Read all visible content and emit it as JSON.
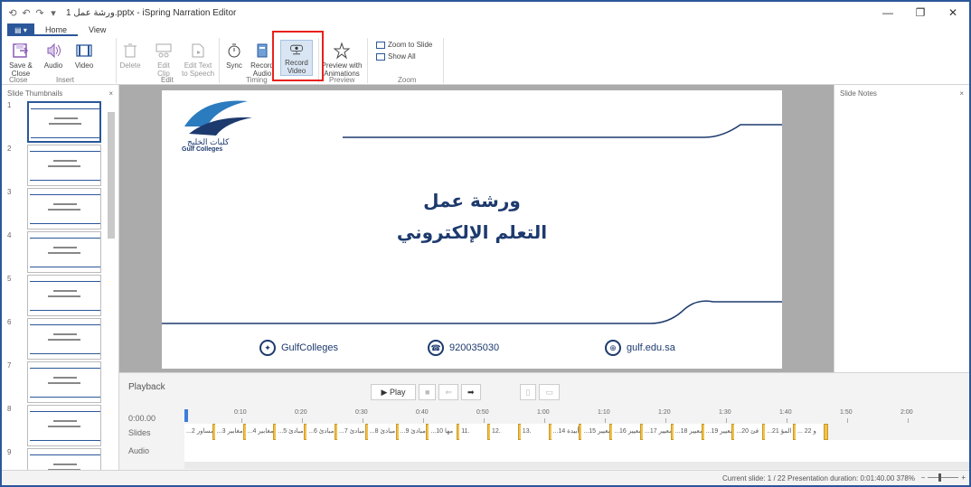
{
  "window": {
    "title": "ورشة عمل 1.pptx - iSpring Narration Editor",
    "controls": [
      "—",
      "❐",
      "✕"
    ]
  },
  "quick_access": [
    "⟲",
    "↶",
    "↷",
    "▾"
  ],
  "ribbon": {
    "file_tab": "▤ ▾",
    "tabs": [
      {
        "label": "Home",
        "active": true
      },
      {
        "label": "View",
        "active": false
      }
    ],
    "buttons": {
      "save_close": "Save &\nClose",
      "audio": "Audio",
      "video": "Video",
      "delete": "Delete",
      "edit_clip": "Edit\nClip",
      "edit_text_to_speech": "Edit Text\nto Speech",
      "sync": "Sync",
      "record_audio": "Record\nAudio",
      "record_video": "Record\nVideo",
      "preview_with_animations": "Preview with\nAnimations",
      "zoom_to_slide": "Zoom to Slide",
      "show_all": "Show All"
    },
    "groups": {
      "close": "Close",
      "insert": "Insert",
      "edit": "Edit",
      "timing": "Timing",
      "preview": "Preview",
      "zoom": "Zoom"
    },
    "accent_color": "#2b579a",
    "highlight_color": "#e8211c"
  },
  "thumbnails": {
    "title": "Slide Thumbnails",
    "close": "×",
    "items": [
      "1",
      "2",
      "3",
      "4",
      "5",
      "6",
      "7",
      "8",
      "9"
    ],
    "selected": "1"
  },
  "slide": {
    "logo_arabic": "كليات الخليج",
    "logo_english": "Gulf Colleges",
    "title_line1": "ورشة عمل",
    "title_line2": "التعلم الإلكتروني",
    "twitter": "GulfColleges",
    "phone": "920035030",
    "website": "gulf.edu.sa",
    "brand_color": "#1d3a6e"
  },
  "notes": {
    "title": "Slide Notes",
    "close": "×"
  },
  "playback": {
    "title": "Playback",
    "play_label": "▶ Play",
    "time": "0:00.00",
    "row_slides": "Slides",
    "row_audio": "Audio",
    "ruler_ticks": [
      "0:10",
      "0:20",
      "0:30",
      "0:40",
      "0:50",
      "1:00",
      "1:10",
      "1:20",
      "1:30",
      "1:40",
      "1:50",
      "2:00"
    ],
    "slide_segments": [
      "...مساور 2",
      "...مغابير 3",
      "...مغابير 4",
      "...مبادئ 5",
      "...مبادئ 6",
      "...مبادئ 7",
      "...مبادئ 8",
      "...مبادئ 9",
      "...مها 10",
      "11.",
      "12.",
      "13.",
      "...أبيدة 14",
      "...معيير 15",
      "...معيير 16",
      "...معيير 17",
      "...معيير 18",
      "...معيير 19",
      "...فئ 20",
      "...المؤ 21",
      "... و 22"
    ]
  },
  "status": {
    "text": "Current slide: 1 / 22   Presentation duration: 0:01:40.00   378%",
    "zoom_minus": "−",
    "zoom_plus": "+"
  }
}
